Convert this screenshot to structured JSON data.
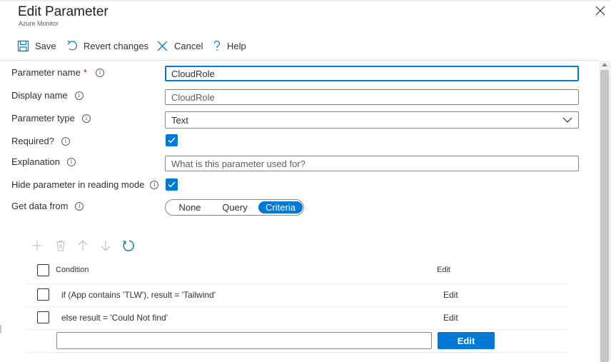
{
  "header": {
    "title": "Edit Parameter",
    "subtitle": "Azure Monitor",
    "close_icon": "close-icon"
  },
  "toolbar": {
    "save_label": "Save",
    "revert_label": "Revert changes",
    "cancel_label": "Cancel",
    "help_label": "Help"
  },
  "form": {
    "parameter_name": {
      "label": "Parameter name",
      "required_mark": "*",
      "value": "CloudRole"
    },
    "display_name": {
      "label": "Display name",
      "value": "CloudRole"
    },
    "parameter_type": {
      "label": "Parameter type",
      "value": "Text"
    },
    "required": {
      "label": "Required?",
      "checked": true
    },
    "explanation": {
      "label": "Explanation",
      "placeholder": "What is this parameter used for?",
      "value": ""
    },
    "hide_in_reading_mode": {
      "label": "Hide parameter in reading mode",
      "checked": true
    },
    "get_data_from": {
      "label": "Get data from",
      "options": [
        "None",
        "Query",
        "Criteria"
      ],
      "selected": "Criteria"
    }
  },
  "criteria_grid": {
    "toolbar_icons": [
      "add-icon",
      "delete-icon",
      "move-up-icon",
      "move-down-icon",
      "refresh-icon"
    ],
    "columns": {
      "condition": "Condition",
      "edit": "Edit"
    },
    "rows": [
      {
        "condition": "if (App contains 'TLW'), result = 'Tailwind'",
        "edit": "Edit"
      },
      {
        "condition": "else result = 'Could Not find'",
        "edit": "Edit"
      }
    ],
    "new_row": {
      "input_value": "",
      "button_label": "Edit"
    }
  },
  "colors": {
    "accent": "#0078d4",
    "required": "#a4262c",
    "text": "#323130",
    "border": "#8a8886"
  }
}
